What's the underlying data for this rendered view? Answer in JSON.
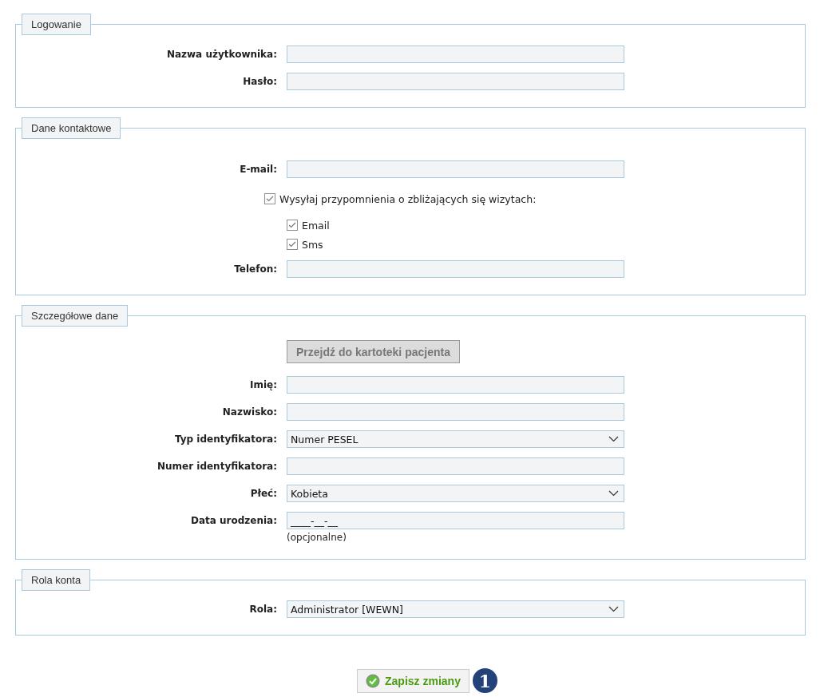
{
  "sections": [
    {
      "legend": "Logowanie",
      "rows": [
        {
          "kind": "text",
          "label": "Nazwa użytkownika:"
        },
        {
          "kind": "password",
          "label": "Hasło:"
        }
      ]
    },
    {
      "legend": "Dane kontaktowe",
      "rows": [
        {
          "kind": "text",
          "label": "E-mail:"
        },
        {
          "kind": "checkbox",
          "label": "Wysyłaj przypomnienia o zbliżających się wizytach:",
          "checked": true,
          "children": [
            {
              "label": "Email",
              "checked": true
            },
            {
              "label": "Sms",
              "checked": true
            }
          ]
        },
        {
          "kind": "text",
          "label": "Telefon:"
        }
      ]
    },
    {
      "legend": "Szczegółowe dane",
      "rows": [
        {
          "kind": "button",
          "label": "Przejdź do kartoteki pacjenta",
          "disabled": true
        },
        {
          "kind": "text",
          "label": "Imię:"
        },
        {
          "kind": "text",
          "label": "Nazwisko:"
        },
        {
          "kind": "select",
          "label": "Typ identyfikatora:",
          "value": "Numer PESEL"
        },
        {
          "kind": "text",
          "label": "Numer identyfikatora:"
        },
        {
          "kind": "select",
          "label": "Płeć:",
          "value": "Kobieta"
        },
        {
          "kind": "text",
          "label": "Data urodzenia:",
          "value": "____-__-__",
          "hint": "(opcjonalne)"
        }
      ]
    },
    {
      "legend": "Rola konta",
      "rows": [
        {
          "kind": "select",
          "label": "Rola:",
          "value": "Administrator [WEWN]"
        }
      ]
    }
  ],
  "save_button": {
    "label": "Zapisz zmiany"
  },
  "step_badge": "1"
}
